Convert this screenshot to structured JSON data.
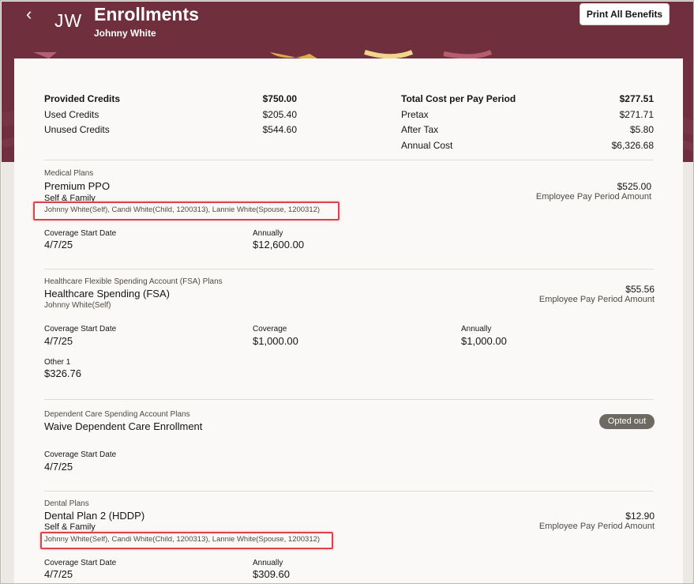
{
  "header": {
    "back_icon": "chevron-left-icon",
    "initials": "JW",
    "title": "Enrollments",
    "subtitle": "Johnny White",
    "print_label": "Print All Benefits",
    "banner_color": "#6f2f3d"
  },
  "summary": {
    "left": {
      "provided_label": "Provided Credits",
      "provided_value": "$750.00",
      "used_label": "Used Credits",
      "used_value": "$205.40",
      "unused_label": "Unused Credits",
      "unused_value": "$544.60"
    },
    "right": {
      "total_label": "Total Cost per Pay Period",
      "total_value": "$277.51",
      "pretax_label": "Pretax",
      "pretax_value": "$271.71",
      "aftertax_label": "After Tax",
      "aftertax_value": "$5.80",
      "annual_label": "Annual Cost",
      "annual_value": "$6,326.68"
    }
  },
  "plans": {
    "medical": {
      "category": "Medical Plans",
      "name": "Premium PPO",
      "option": "Self & Family",
      "participants": "Johnny White(Self), Candi White(Child, 1200313), Lannie White(Spouse, 1200312)",
      "amount": "$525.00",
      "amount_label": "Employee Pay Period Amount",
      "start_label": "Coverage Start Date",
      "start_value": "4/7/25",
      "annually_label": "Annually",
      "annually_value": "$12,600.00"
    },
    "fsa": {
      "category": "Healthcare Flexible Spending Account (FSA) Plans",
      "name": "Healthcare Spending (FSA)",
      "participants": "Johnny White(Self)",
      "amount": "$55.56",
      "amount_label": "Employee Pay Period Amount",
      "start_label": "Coverage Start Date",
      "start_value": "4/7/25",
      "coverage_label": "Coverage",
      "coverage_value": "$1,000.00",
      "annually_label": "Annually",
      "annually_value": "$1,000.00",
      "other_label": "Other 1",
      "other_value": "$326.76"
    },
    "dependent": {
      "category": "Dependent Care Spending Account Plans",
      "name": "Waive Dependent Care Enrollment",
      "status": "Opted out",
      "start_label": "Coverage Start Date",
      "start_value": "4/7/25"
    },
    "dental": {
      "category": "Dental Plans",
      "name": "Dental Plan 2 (HDDP)",
      "option": "Self & Family",
      "participants": "Johnny White(Self), Candi White(Child, 1200313), Lannie White(Spouse, 1200312)",
      "amount": "$12.90",
      "amount_label": "Employee Pay Period Amount",
      "start_label": "Coverage Start Date",
      "start_value": "4/7/25",
      "annually_label": "Annually",
      "annually_value": "$309.60"
    }
  }
}
